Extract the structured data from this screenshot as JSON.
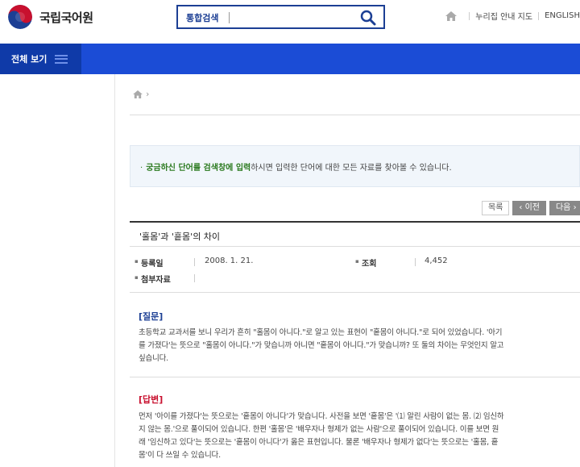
{
  "header": {
    "logo_name": "국립국어원",
    "search_label": "통합검색",
    "search_placeholder": "",
    "util_links": [
      "누리집 안내 지도",
      "ENGLISH"
    ]
  },
  "nav": {
    "all_view": "전체 보기"
  },
  "notice": {
    "highlight": "궁금하신 단어를 검색창에 입력",
    "rest": "하시면 입력한 단어에 대한 모든 자료를 찾아볼 수 있습니다."
  },
  "buttons": {
    "list": "목록",
    "prev": "‹ 이전",
    "next": "다음 ›"
  },
  "post": {
    "title": "'홀몸'과 '흩몸'의 차이",
    "date_label": "등록일",
    "date_value": "2008. 1. 21.",
    "views_label": "조회",
    "views_value": "4,452",
    "attach_label": "첨부자료"
  },
  "question": {
    "heading": "[질문]",
    "lines": [
      "초등학교 교과서를 보니 우리가 흔히 \"홀몸이 아니다.\"로 알고 있는 표현이 \"홑몸이 아니다.\"로 되어 있었습니다. '아기",
      "를 가졌다'는 뜻으로 \"홀몸이 아니다.\"가 맞습니까 아니면 \"홑몸이 아니다.\"가 맞습니까? 또 둘의 차이는 무엇인지 알고",
      "싶습니다."
    ]
  },
  "answer": {
    "heading": "[답변]",
    "lines": [
      "먼저 '아이를 가졌다'는 뜻으로는 '홑몸이 아니다'가 맞습니다. 사전을 보면 '홑몸'은 '⑴ 알린 사람이 없는 몸. ⑵ 임신하",
      "지 않는 몸.'으로 풀이되어 있습니다. 한편 '홀몸'은 '배우자나 형제가 없는 사람'으로 풀이되어 있습니다. 이를 보면 원",
      "래 '임신하고 있다'는 뜻으로는 '홑몸이 아니다'가 옳은 표현입니다. 물론 '배우자나 형제가 없다'는 뜻으로는 '홀몸, 홑",
      "몸'이 다 쓰일 수 있습니다."
    ]
  },
  "colors": {
    "brand_blue": "#1b4cd6",
    "dark_blue": "#0f3aa8",
    "question_color": "#1c3f94",
    "answer_color": "#c8102e",
    "highlight_green": "#2b7a1f"
  }
}
